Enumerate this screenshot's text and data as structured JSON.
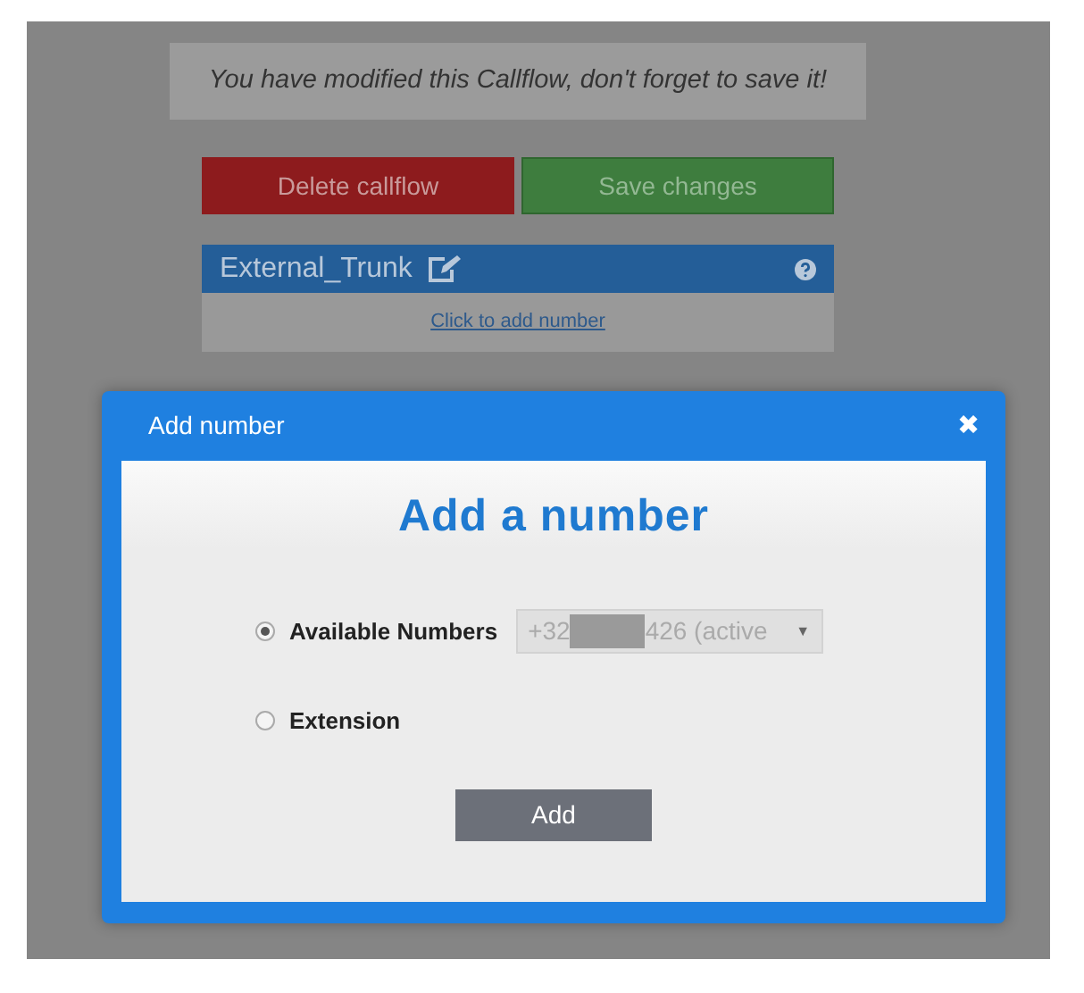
{
  "notice": "You have modified this Callflow, don't forget to save it!",
  "actions": [
    {
      "label": "Delete callflow",
      "kind": "danger"
    },
    {
      "label": "Save changes",
      "kind": "success"
    }
  ],
  "trunk": {
    "title": "External_Trunk",
    "body": "Click to add number"
  },
  "dialog": {
    "title": "Add number",
    "close": "✖",
    "heading": "Add a number",
    "options": [
      {
        "label": "Available Numbers",
        "selected": true,
        "select": {
          "value_start": "+32",
          "value_end": "426 (active",
          "caret": "▼"
        }
      },
      {
        "label": "Extension",
        "selected": false
      }
    ],
    "submit": "Add"
  }
}
